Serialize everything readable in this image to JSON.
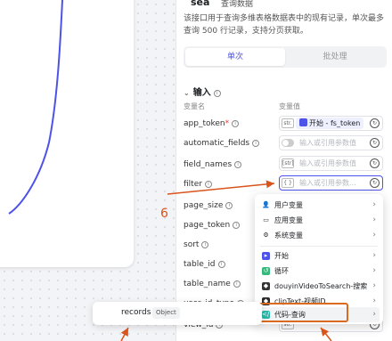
{
  "header": {
    "title": "sea",
    "subtitle": "查询数据"
  },
  "description": "该接口用于查询多维表格数据表中的现有记录，单次最多查询 500 行记录，支持分页获取。",
  "tabs": [
    {
      "label": "单次"
    },
    {
      "label": "批处理"
    }
  ],
  "input_section": {
    "title": "输入",
    "col_name": "变量名",
    "col_value": "变量值"
  },
  "rows": [
    {
      "name": "app_token",
      "required": "*",
      "type": "str.",
      "chip": "开始 - fs_token"
    },
    {
      "name": "automatic_fields",
      "placeholder": "输入或引用参数值"
    },
    {
      "name": "field_names",
      "type": "[str]",
      "placeholder": "输入或引用参数值"
    },
    {
      "name": "filter",
      "type": "{ }",
      "placeholder": "输入或引用参数..."
    },
    {
      "name": "page_size"
    },
    {
      "name": "page_token"
    },
    {
      "name": "sort"
    },
    {
      "name": "table_id"
    },
    {
      "name": "table_name"
    },
    {
      "name": "user_id_type"
    },
    {
      "name": "view_id",
      "type": "str."
    }
  ],
  "dropdown": {
    "items": [
      {
        "label": "用户变量",
        "icon": "user-icon"
      },
      {
        "label": "应用变量",
        "icon": "folder-icon"
      },
      {
        "label": "系统变量",
        "icon": "gear-icon"
      },
      {
        "label": "开始",
        "icon": "start-node-icon"
      },
      {
        "label": "循环",
        "icon": "loop-node-icon"
      },
      {
        "label": "douyinVideoToSearch-搜索",
        "icon": "plugin-icon"
      },
      {
        "label": "clipText-视频ID",
        "icon": "plugin-icon"
      },
      {
        "label": "代码-查询",
        "icon": "code-node-icon"
      }
    ]
  },
  "records_popup": {
    "name": "records",
    "type": "Object"
  },
  "annotation": "6",
  "colors": {
    "accent": "#4d53e8",
    "annotation": "#d9541b"
  }
}
